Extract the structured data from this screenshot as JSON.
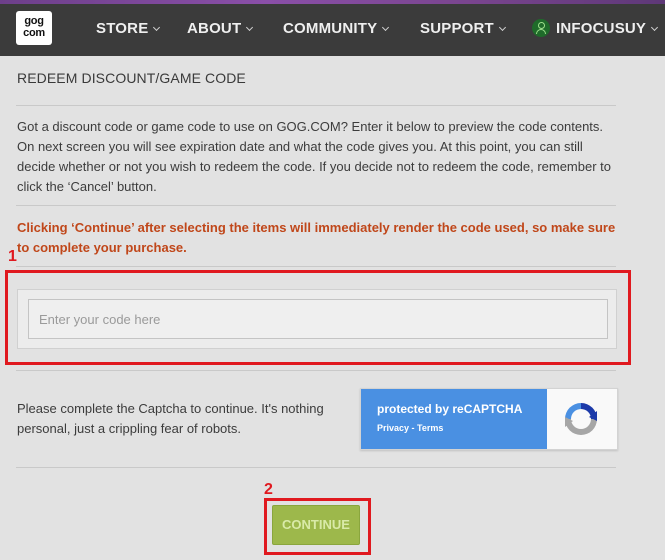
{
  "header": {
    "logo_line1": "gog",
    "logo_line2": "com",
    "nav": [
      {
        "label": "STORE"
      },
      {
        "label": "ABOUT"
      },
      {
        "label": "COMMUNITY"
      },
      {
        "label": "SUPPORT"
      }
    ],
    "username": "INFOCUSUY"
  },
  "page": {
    "title": "REDEEM DISCOUNT/GAME CODE",
    "description": "Got a discount code or game code to use on GOG.COM? Enter it below to preview the code contents. On next screen you will see expiration date and what the code gives you. At this point, you can still decide whether or not you wish to redeem the code. If you decide not to redeem the code, remember to click the ‘Cancel’ button.",
    "warning": "Clicking ‘Continue’ after selecting the items will immediately render the code used, so make sure to complete your purchase.",
    "code_input_placeholder": "Enter your code here",
    "captcha_prompt": "Please complete the Captcha to continue. It's nothing personal, just a crippling fear of robots.",
    "recaptcha_title": "protected by reCAPTCHA",
    "recaptcha_links": "Privacy - Terms",
    "continue_label": "CONTINUE"
  },
  "annotations": [
    {
      "label": "1"
    },
    {
      "label": "2"
    }
  ],
  "colors": {
    "header_bg": "#3b3b3b",
    "warning": "#c0471a",
    "continue_bg": "#9db84b",
    "recaptcha_blue": "#4a90e2",
    "annotation_red": "#e0191f"
  }
}
